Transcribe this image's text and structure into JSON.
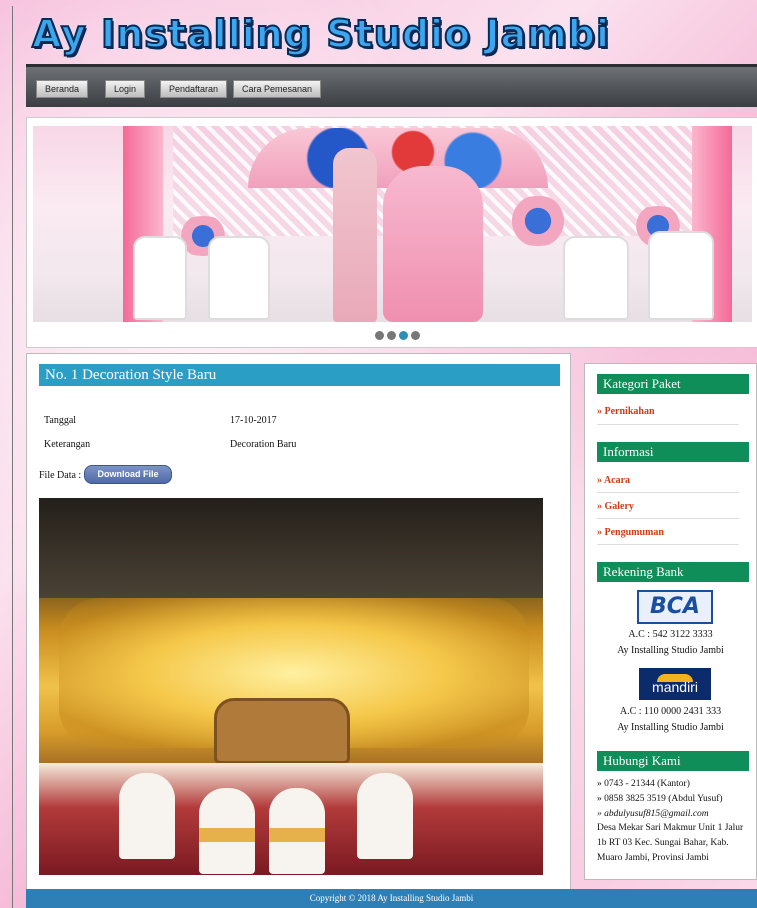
{
  "header": {
    "title": "Ay Installing Studio Jambi"
  },
  "nav": {
    "items": [
      "Beranda",
      "Login",
      "Pendaftaran",
      "Cara Pemesanan"
    ]
  },
  "slider": {
    "dots": 4,
    "active_dot": 3
  },
  "post": {
    "title": "No. 1 Decoration Style Baru",
    "fields": [
      {
        "label": "Tanggal",
        "value": "17-10-2017"
      },
      {
        "label": "Keterangan",
        "value": "Decoration Baru"
      }
    ],
    "file_label": "File Data :",
    "download_label": "Download File"
  },
  "sidebar": {
    "kategori": {
      "title": "Kategori Paket",
      "links": [
        "» Pernikahan"
      ]
    },
    "informasi": {
      "title": "Informasi",
      "links": [
        "» Acara",
        "» Galery",
        "» Pengumuman"
      ]
    },
    "rekening": {
      "title": "Rekening Bank",
      "banks": [
        {
          "logo": "BCA",
          "account": "A.C : 542 3122 3333",
          "holder": "Ay Installing Studio Jambi"
        },
        {
          "logo": "mandiri",
          "account": "A.C : 110 0000 2431 333",
          "holder": "Ay Installing Studio Jambi"
        }
      ]
    },
    "hubungi": {
      "title": "Hubungi Kami",
      "phone_office": "» 0743 - 21344 (Kantor)",
      "phone_mobile": "» 0858 3825 3519 (Abdul Yusuf)",
      "email": "» abdulyusuf815@gmail.com",
      "address": "Desa Mekar Sari Makmur Unit 1 Jalur 1b RT 03 Kec. Sungai Bahar, Kab. Muaro Jambi, Provinsi Jambi"
    }
  },
  "footer": {
    "copyright": "Copyright © 2018 Ay Installing Studio Jambi"
  },
  "colors": {
    "accent_blue": "#2b9ec5",
    "sidebar_green": "#0f8e5a",
    "link_red": "#d23b15",
    "footer_blue": "#2e7fb5"
  }
}
